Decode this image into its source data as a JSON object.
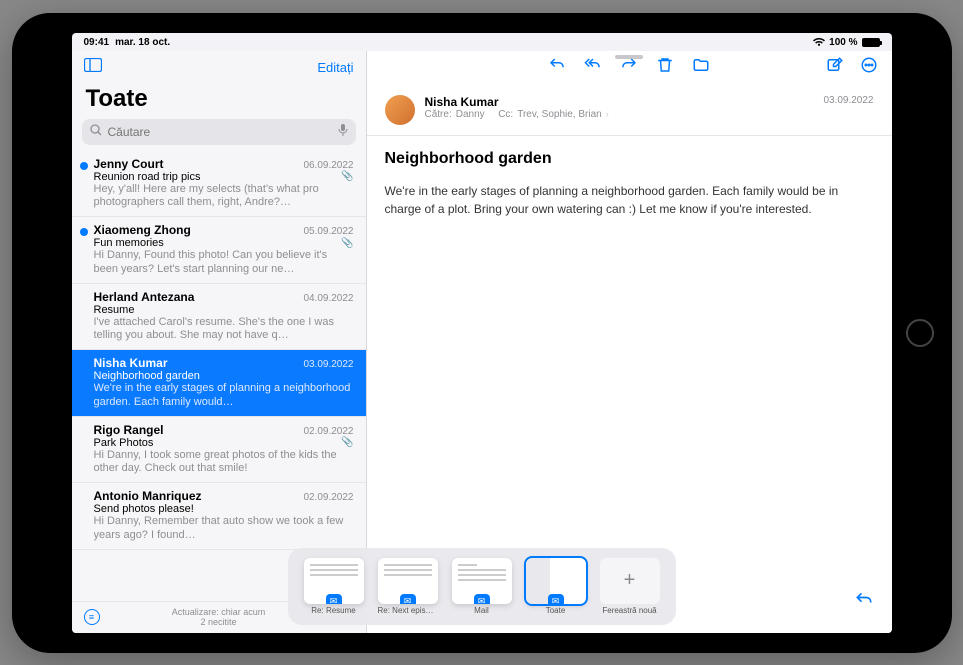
{
  "status": {
    "time": "09:41",
    "date": "mar. 18 oct.",
    "battery_pct": "100 %"
  },
  "sidebar": {
    "edit_label": "Editați",
    "title": "Toate",
    "search_placeholder": "Căutare",
    "footer_line1": "Actualizare: chiar acum",
    "footer_line2": "2 necitite"
  },
  "messages": [
    {
      "sender": "Jenny Court",
      "date": "06.09.2022",
      "subject": "Reunion road trip pics",
      "preview": "Hey, y'all! Here are my selects (that's what pro photographers call them, right, Andre?…",
      "unread": true,
      "attachment": true
    },
    {
      "sender": "Xiaomeng Zhong",
      "date": "05.09.2022",
      "subject": "Fun memories",
      "preview": "Hi Danny, Found this photo! Can you believe it's been years? Let's start planning our ne…",
      "unread": true,
      "attachment": true
    },
    {
      "sender": "Herland Antezana",
      "date": "04.09.2022",
      "subject": "Resume",
      "preview": "I've attached Carol's resume. She's the one I was telling you about. She may not have q…",
      "unread": false,
      "attachment": false
    },
    {
      "sender": "Nisha Kumar",
      "date": "03.09.2022",
      "subject": "Neighborhood garden",
      "preview": "We're in the early stages of planning a neighborhood garden. Each family would…",
      "unread": false,
      "attachment": false,
      "selected": true
    },
    {
      "sender": "Rigo Rangel",
      "date": "02.09.2022",
      "subject": "Park Photos",
      "preview": "Hi Danny, I took some great photos of the kids the other day. Check out that smile!",
      "unread": false,
      "attachment": true
    },
    {
      "sender": "Antonio Manriquez",
      "date": "02.09.2022",
      "subject": "Send photos please!",
      "preview": "Hi Danny, Remember that auto show we took a few years ago? I found…",
      "unread": false,
      "attachment": false
    }
  ],
  "email": {
    "from": "Nisha Kumar",
    "to_label": "Către:",
    "to": "Danny",
    "cc_label": "Cc:",
    "cc": "Trev, Sophie, Brian",
    "date": "03.09.2022",
    "subject": "Neighborhood garden",
    "body": "We're in the early stages of planning a neighborhood garden. Each family would be in charge of a plot. Bring your own watering can :) Let me know if you're interested."
  },
  "shelf": {
    "items": [
      {
        "label": "Re: Resume"
      },
      {
        "label": "Re: Next episode's g…"
      },
      {
        "label": "Mail"
      },
      {
        "label": "Toate",
        "active": true
      }
    ],
    "new_label": "Fereastră nouă"
  }
}
